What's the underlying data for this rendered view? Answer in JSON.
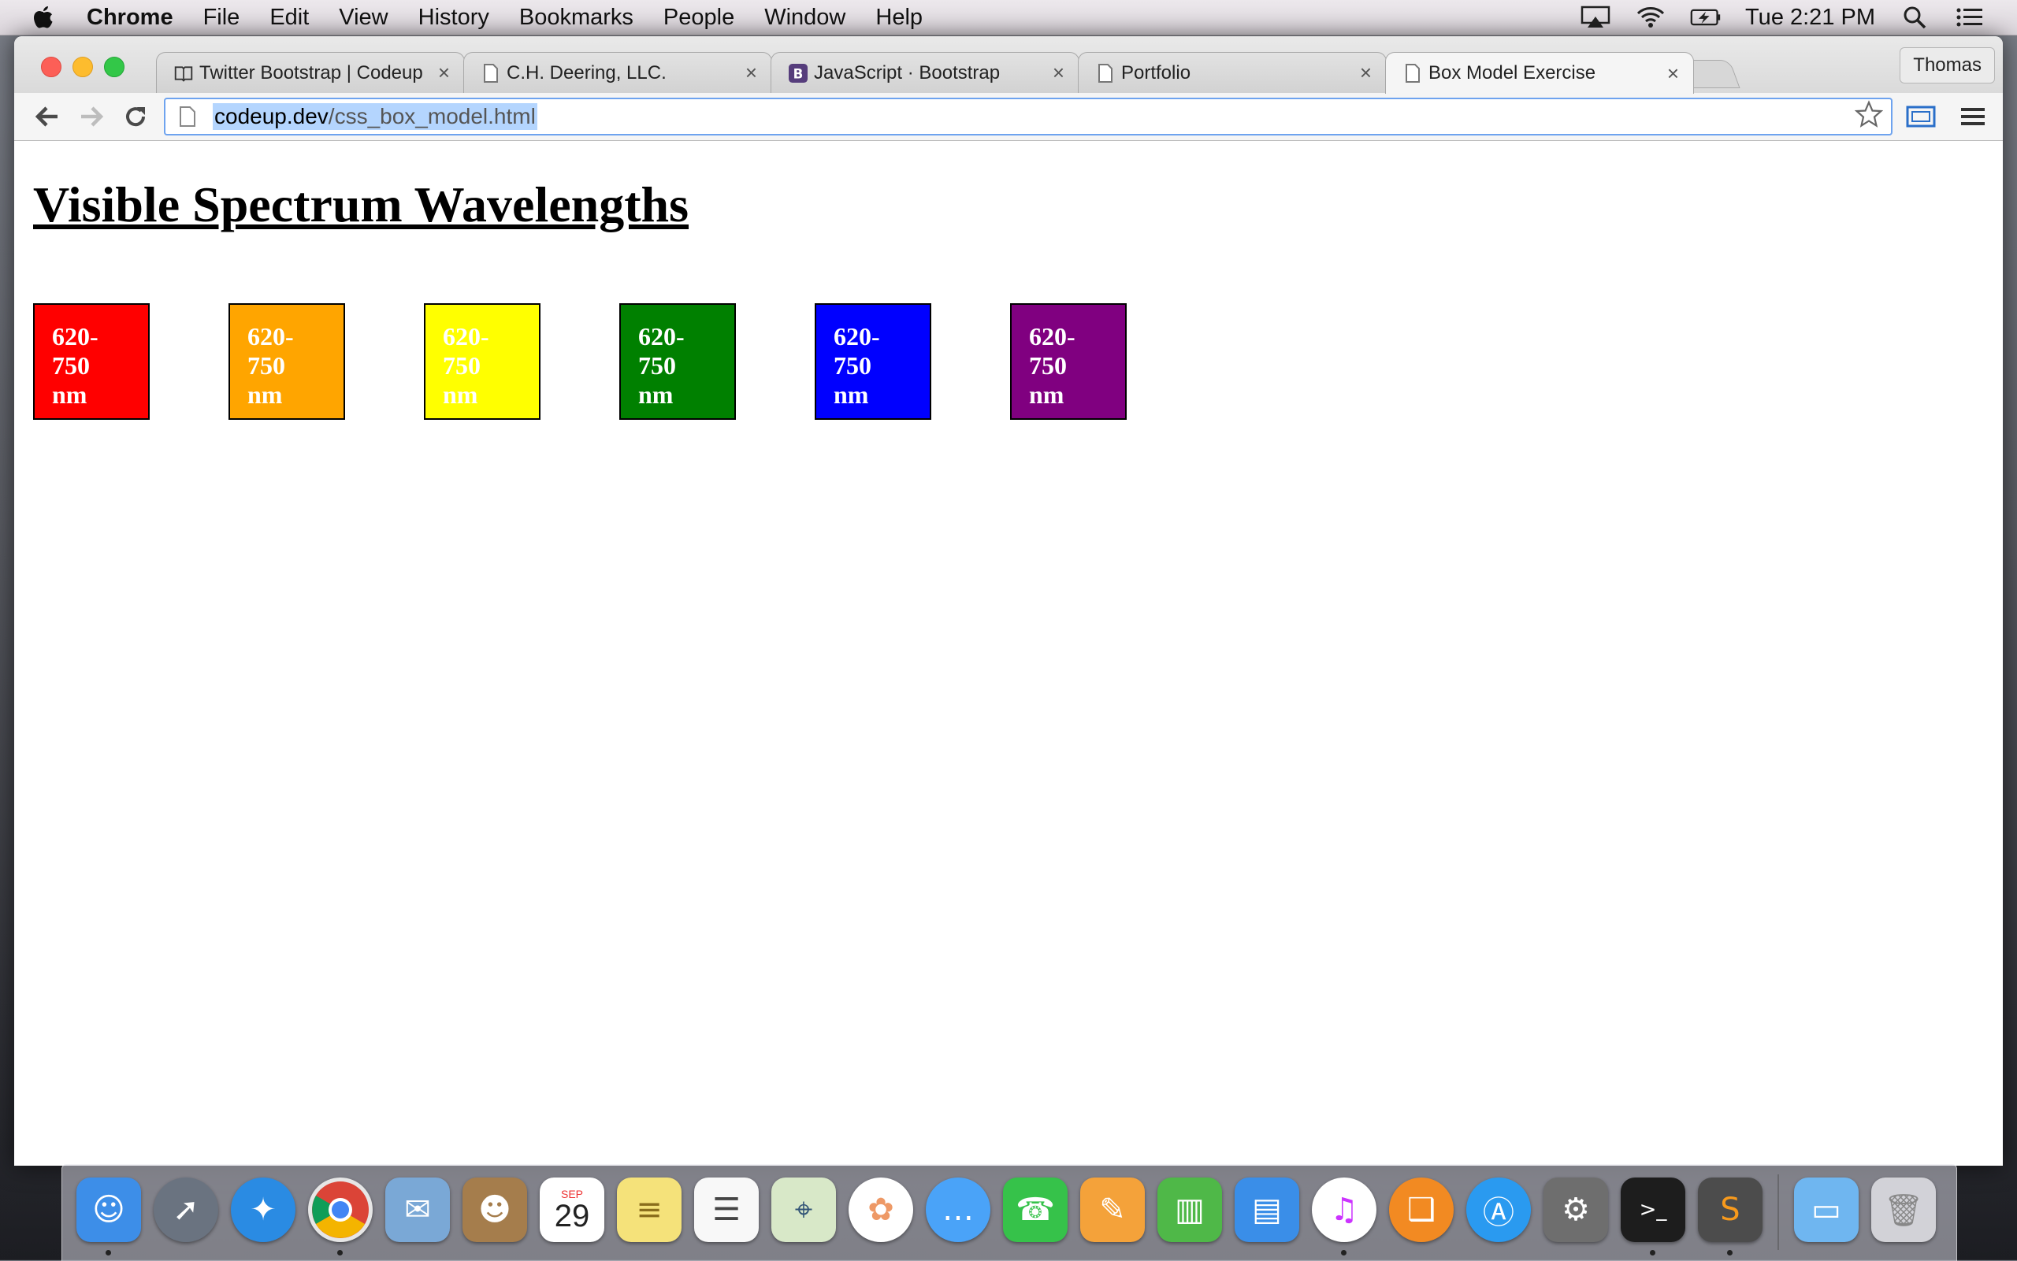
{
  "menubar": {
    "app_name": "Chrome",
    "items": [
      "File",
      "Edit",
      "View",
      "History",
      "Bookmarks",
      "People",
      "Window",
      "Help"
    ],
    "clock": "Tue 2:21 PM"
  },
  "tabs": [
    {
      "title": "Twitter Bootstrap | Codeup",
      "icon": "book-icon"
    },
    {
      "title": "C.H. Deering, LLC.",
      "icon": "page-icon"
    },
    {
      "title": "JavaScript · Bootstrap",
      "icon": "bootstrap-icon"
    },
    {
      "title": "Portfolio",
      "icon": "page-icon"
    },
    {
      "title": "Box Model Exercise",
      "icon": "page-icon",
      "active": true
    }
  ],
  "tab_close_glyph": "×",
  "profile": "Thomas",
  "address": {
    "host": "codeup.dev",
    "path": "/css_box_model.html"
  },
  "page": {
    "heading": "Visible Spectrum Wavelengths",
    "swatches": [
      {
        "label": "620-750 nm",
        "color": "#ff0000"
      },
      {
        "label": "620-750 nm",
        "color": "#ffa500"
      },
      {
        "label": "620-750 nm",
        "color": "#ffff00"
      },
      {
        "label": "620-750 nm",
        "color": "#008000"
      },
      {
        "label": "620-750 nm",
        "color": "#0000ff"
      },
      {
        "label": "620-750 nm",
        "color": "#800080"
      }
    ]
  },
  "dock": {
    "apps": [
      "Finder",
      "Launchpad",
      "Safari",
      "Chrome",
      "Mail",
      "Contacts",
      "Calendar",
      "Notes",
      "Reminders",
      "Maps",
      "Photos",
      "Messages",
      "FaceTime",
      "Pages",
      "Numbers",
      "Keynote",
      "iTunes",
      "iBooks",
      "App Store",
      "System Preferences",
      "Terminal",
      "Sublime Text"
    ],
    "calendar": {
      "month": "SEP",
      "day": "29"
    },
    "colors": {
      "Finder": "#3d8ee8",
      "Launchpad": "#6a7380",
      "Safari": "#2a8be3",
      "Chrome": "#e6e6e6",
      "Mail": "#7aa8d6",
      "Contacts": "#a57d4c",
      "Calendar": "#ffffff",
      "Notes": "#f5e27a",
      "Reminders": "#f8f8f8",
      "Maps": "#d8e8c8",
      "Photos": "#ffffff",
      "Messages": "#4aa3f8",
      "FaceTime": "#36c24a",
      "Pages": "#f4a23a",
      "Numbers": "#4fb848",
      "Keynote": "#3a8ee8",
      "iTunes": "#ffffff",
      "iBooks": "#f28a22",
      "App Store": "#2a9af0",
      "System Preferences": "#6e6e6e",
      "Terminal": "#1d1d1d",
      "Sublime Text": "#4c4c4c"
    }
  }
}
